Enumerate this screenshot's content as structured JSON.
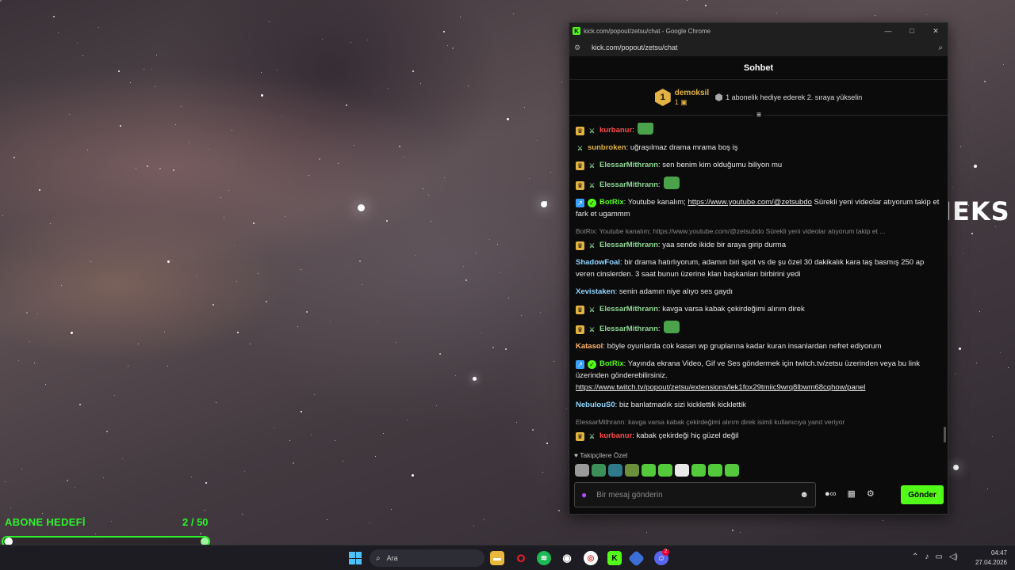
{
  "browser": {
    "window_title": "kick.com/popout/zetsu/chat - Google Chrome",
    "address": "kick.com/popout/zetsu/chat"
  },
  "chat": {
    "header": "Sohbet",
    "pinned": {
      "rank": "1",
      "user": "demoksil",
      "count": "1",
      "message": "1 abonelik hediye ederek 2. sıraya yükselin"
    },
    "messages": [
      {
        "user": "ElessarMithrann",
        "color": "#8fd694",
        "text": ":",
        "badges": [
          "sub",
          "sword"
        ],
        "emote": true
      },
      {
        "user": "kurbanur",
        "color": "#ff4b4b",
        "text": ":",
        "badges": [
          "sub",
          "sword"
        ],
        "emote": true
      },
      {
        "user": "sunbroken",
        "color": "#e3b341",
        "text": ": uğraşılmaz drama mrama boş iş",
        "badges": [
          "sword"
        ]
      },
      {
        "user": "ElessarMithrann",
        "color": "#8fd694",
        "text": ": sen benim kim olduğumu biliyon mu",
        "badges": [
          "sub",
          "sword"
        ]
      },
      {
        "user": "ElessarMithrann",
        "color": "#8fd694",
        "text": ":",
        "badges": [
          "sub",
          "sword"
        ],
        "emote": true
      },
      {
        "user": "BotRix",
        "color": "#53fc18",
        "text": ": Youtube kanalım; ",
        "link": "https://www.youtube.com/@zetsubdo",
        "text2": " Sürekli yeni videolar atıyorum takip et fark et ugammm",
        "badges": [
          "bot",
          "ver"
        ]
      },
      {
        "reply": "BotRix: Youtube kanalım; https://www.youtube.com/@zetsubdo Sürekli yeni videolar atıyorum takip et ...",
        "user": "ElessarMithrann",
        "color": "#8fd694",
        "text": ": yaa sende ikide bir araya girip durma",
        "badges": [
          "sub",
          "sword"
        ]
      },
      {
        "user": "ShadowFoal",
        "color": "#8fd6ff",
        "text": ": bir drama hatırlıyorum, adamın biri spot vs de şu özel 30 dakikalık kara taş basmış 250 ap veren cinslerden. 3 saat bunun üzerine klan başkanları birbirini yedi",
        "badges": []
      },
      {
        "user": "Xevistaken",
        "color": "#8fd6ff",
        "text": ": senin adamın niye alıyo ses gaydı",
        "badges": []
      },
      {
        "user": "ElessarMithrann",
        "color": "#8fd694",
        "text": ": kavga varsa kabak çekirdeğimi alırım direk",
        "badges": [
          "sub",
          "sword"
        ]
      },
      {
        "user": "ElessarMithrann",
        "color": "#8fd694",
        "text": ":",
        "badges": [
          "sub",
          "sword"
        ],
        "emote": true
      },
      {
        "user": "Katasol",
        "color": "#ffb86b",
        "text": ": böyle oyunlarda cok kasan wp gruplarına kadar kuran insanlardan nefret ediyorum",
        "badges": []
      },
      {
        "user": "BotRix",
        "color": "#53fc18",
        "text": ": Yayında ekrana Video, Gif ve Ses göndermek için twitch.tv/zetsu üzerinden veya bu link üzerinden gönderebilirsiniz. ",
        "link": "https://www.twitch.tv/popout/zetsu/extensions/lek1fox29tmiic9wrq8lbwm68cqhow/panel",
        "text2": "",
        "badges": [
          "bot",
          "ver"
        ]
      },
      {
        "user": "NebulouS0",
        "color": "#8fd6ff",
        "text": ": biz banlatmadık sizi kicklettik kicklettik",
        "badges": []
      },
      {
        "reply": "ElessarMithrann: kavga varsa kabak çekirdeğimi alırım direk isimli kullanıcıya yanıt veriyor",
        "user": "kurbanur",
        "color": "#ff4b4b",
        "text": ": kabak çekirdeği hiç güzel değil",
        "badges": [
          "sub",
          "sword"
        ]
      }
    ],
    "emote_section_label": "Takipçilere Özel",
    "input_placeholder": "Bir mesaj gönderin",
    "send_label": "Gönder"
  },
  "overlay": {
    "watermark": "OYUNEKS",
    "goal_title": "ABONE HEDEFİ",
    "goal_count": "2 / 50",
    "goal_progress": 0.04
  },
  "taskbar": {
    "search_placeholder": "Ara",
    "discord_badge": "2",
    "time": "04:47",
    "date": "27.04.2026"
  },
  "colors": {
    "kick_green": "#53fc18",
    "goal_green": "#2cf22c"
  }
}
